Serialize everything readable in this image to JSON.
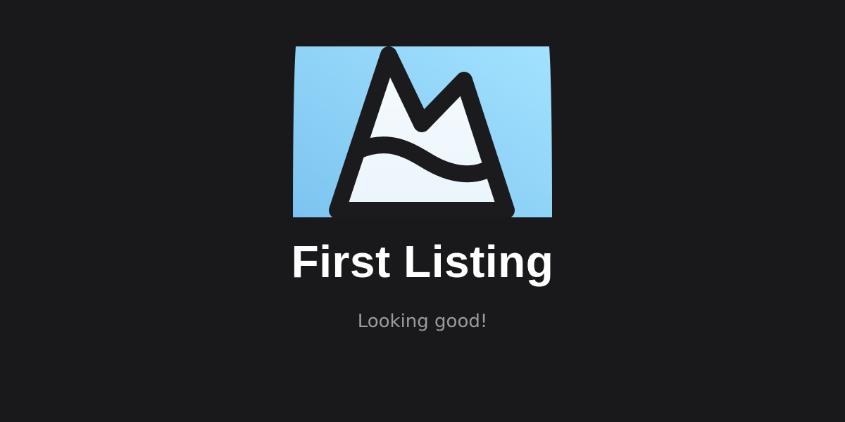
{
  "achievement": {
    "icon": "mountain-icon",
    "title": "First Listing",
    "subtitle": "Looking good!"
  },
  "colors": {
    "background": "#19191b",
    "icon_sky_light": "#9fe0ff",
    "icon_sky_dark": "#7ec6f2",
    "icon_snow": "#f3f9fd",
    "icon_outline": "#1b1b1d",
    "title": "#ffffff",
    "subtitle": "#9a9aa0"
  }
}
